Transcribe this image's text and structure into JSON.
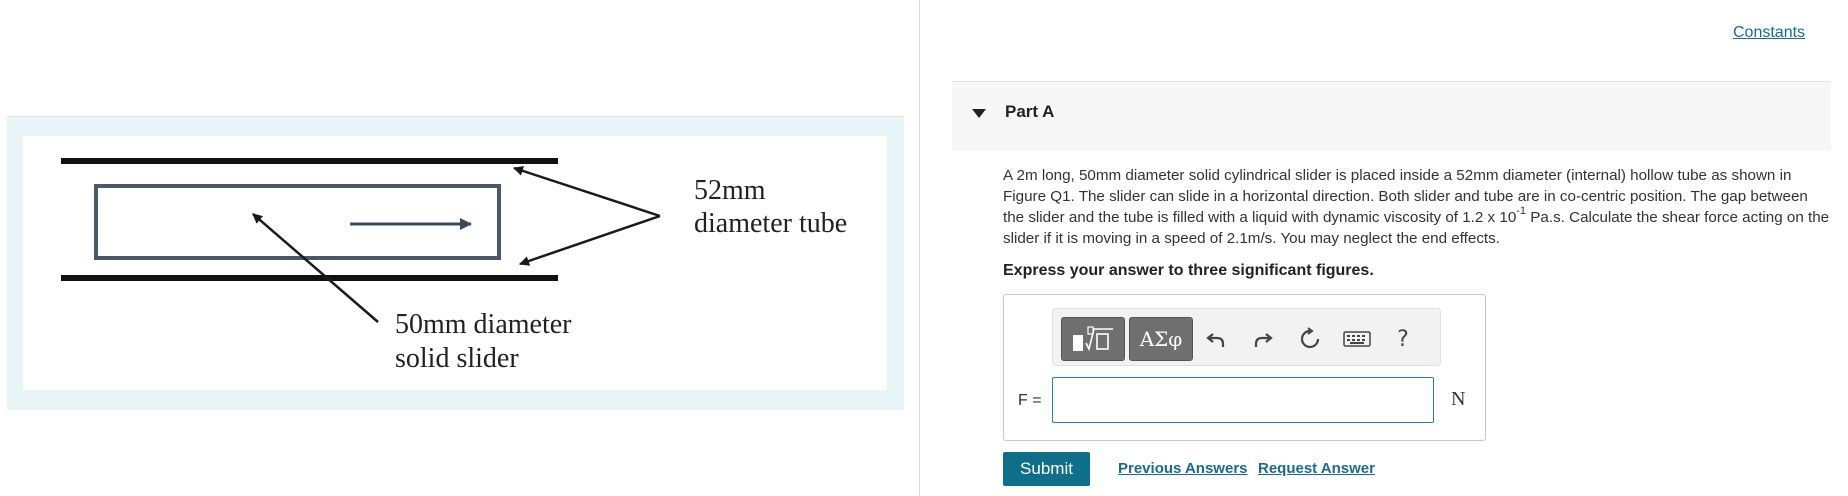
{
  "figure": {
    "tube_label_line1": "52mm",
    "tube_label_line2": "diameter tube",
    "slider_label_line1": "50mm diameter",
    "slider_label_line2": "solid slider"
  },
  "header": {
    "constants_link": "Constants"
  },
  "part": {
    "title": "Part A",
    "question_part1": "A 2m long, 50mm diameter solid cylindrical slider is placed inside a 52mm diameter (internal) hollow tube as shown in Figure Q1. The slider can slide in a horizontal direction.  Both slider and tube are in co-centric position. The gap between the slider and the tube is filled with a liquid with dynamic viscosity of 1.2 x 10",
    "question_exponent": "-1",
    "question_part2": " Pa.s. Calculate the shear force acting on the slider if it is moving in a speed of 2.1m/s. You may neglect the end effects.",
    "instruction": "Express your answer to three significant figures."
  },
  "answer": {
    "variable_label": "F =",
    "value": "",
    "unit": "N",
    "toolbar": {
      "templates_icon": "templates-icon",
      "symbols_label": "ΑΣφ",
      "undo_icon": "undo-icon",
      "redo_icon": "redo-icon",
      "reset_icon": "reset-icon",
      "keyboard_icon": "keyboard-icon",
      "help_label": "?"
    }
  },
  "actions": {
    "submit_label": "Submit",
    "previous_answers_label": "Previous Answers",
    "request_answer_label": "Request Answer"
  },
  "colors": {
    "accent": "#0f6e8a",
    "link": "#1a6b8f",
    "figure_frame": "#e8f5f7"
  }
}
